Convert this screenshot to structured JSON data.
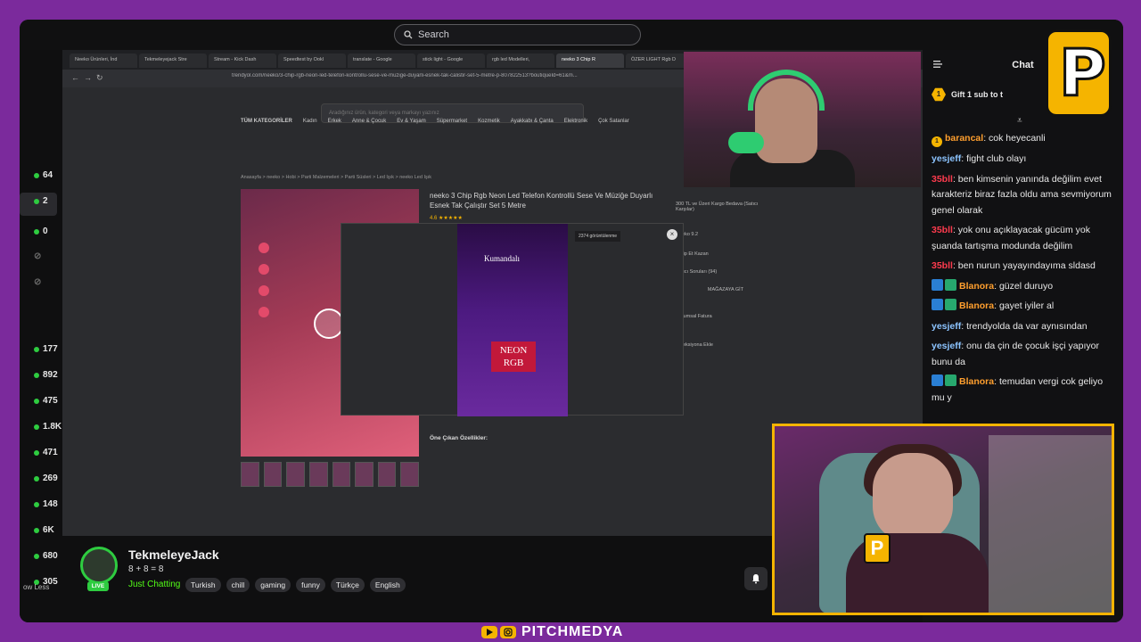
{
  "topbar": {
    "search_placeholder": "Search"
  },
  "leftnav": {
    "items": [
      {
        "value": "64",
        "live": true
      },
      {
        "value": "2",
        "live": true
      },
      {
        "value": "0",
        "live": true
      },
      {
        "value": "",
        "live": false
      },
      {
        "value": "",
        "live": false
      },
      {
        "value": "177",
        "live": true
      },
      {
        "value": "892",
        "live": true
      },
      {
        "value": "475",
        "live": true
      },
      {
        "value": "1.8K",
        "live": true
      },
      {
        "value": "471",
        "live": true
      },
      {
        "value": "269",
        "live": true
      },
      {
        "value": "148",
        "live": true
      },
      {
        "value": "6K",
        "live": true
      },
      {
        "value": "680",
        "live": true
      },
      {
        "value": "305",
        "live": true
      }
    ],
    "show_less": "ow Less"
  },
  "stream": {
    "tabs": [
      "Neeko Ürünleri, İnd",
      "Tekmeleyejack Stre",
      "Stream - Kick Dash",
      "Speedtest by Ookl",
      "translate - Google",
      "stick light - Google",
      "rgb led Modelleri,",
      "neeko 3 Chip R",
      "ÖZER LIGHT Rgb D"
    ],
    "url": "trendyol.com/neeko/3-chip-rgb-neon-led-telefon-kontrollu-sese-ve-muzige-duyarli-esnek-tak-calistir-set-5-metre-p-807822513?boutiqueId=61&m...",
    "site_search_placeholder": "Aradığınız ürün, kategori veya markayı yazınız",
    "categories": [
      "TÜM KATEGORİLER",
      "Kadın",
      "Erkek",
      "Anne & Çocuk",
      "Ev & Yaşam",
      "Süpermarket",
      "Kozmetik",
      "Ayakkabı & Çanta",
      "Elektronik",
      "Çok Satanlar"
    ],
    "breadcrumb": "Anasayfa  >  neeko  >  Hobi  >  Parti Malzemeleri  >  Parti Süsleri  >  Led Işık  >  neeko Led Işık",
    "product_title": "neeko 3 Chip Rgb Neon Led Telefon Kontrollü Sese Ve Müziğe Duyarlı Esnek Tak Çalıştır Set 5 Metre",
    "rating": "4.6",
    "features_title": "Öne Çıkan Özellikler:",
    "modal": {
      "views": "2374 görüntülenme",
      "video_label": "Kumandalı",
      "neon_line1": "NEON",
      "neon_line2": "RGB",
      "close": "×"
    },
    "side_panel": [
      "300 TL ve Üzeri Kargo Bedava (Satıcı Karşılar)",
      "Neeko 9.2",
      "Takip Et Kazan",
      "Satıcı Soruları (94)",
      "MAĞAZAYA GİT",
      "Kurumsal Fatura",
      "Koleksiyona Ekle"
    ]
  },
  "channel": {
    "name": "TekmeleyeJack",
    "title": "8 + 8 = 8",
    "category": "Just Chatting",
    "live_label": "LIVE",
    "tags": [
      "Turkish",
      "chill",
      "gaming",
      "funny",
      "Türkçe",
      "English"
    ]
  },
  "chat": {
    "header": "Chat",
    "gift_text": "Gift 1 sub to t",
    "gift_count": "1",
    "messages": [
      {
        "user": "barancal",
        "color": "orange",
        "badge": "1",
        "text": "cok heyecanli"
      },
      {
        "user": "yesjeff",
        "color": "blue",
        "text": "fight club olayı"
      },
      {
        "user": "35bll",
        "color": "red",
        "text": "ben kimsenin yanında değilim evet karakteriz biraz fazla oldu ama sevmiyorum genel olarak"
      },
      {
        "user": "35bll",
        "color": "red",
        "text": "yok onu açıklayacak gücüm yok şuanda tartışma modunda değilim"
      },
      {
        "user": "35bll",
        "color": "red",
        "text": "ben nurun yayayındayıma sldasd"
      },
      {
        "user": "Blanora",
        "color": "orange",
        "mod": true,
        "text": "güzel duruyo"
      },
      {
        "user": "Blanora",
        "color": "orange",
        "mod": true,
        "text": "gayet iyiler al"
      },
      {
        "user": "yesjeff",
        "color": "blue",
        "text": "trendyolda da var aynısından"
      },
      {
        "user": "yesjeff",
        "color": "blue",
        "text": "onu da çin de çocuk işçi yapıyor bunu da"
      },
      {
        "user": "Blanora",
        "color": "orange",
        "mod": true,
        "text": "temudan vergi cok geliyo mu y"
      }
    ]
  },
  "overlay": {
    "logo_letter": "P",
    "brand": "PITCHMEDYA"
  },
  "colors": {
    "kick_green": "#53fc18",
    "frame_purple": "#7b2a9c",
    "gold": "#f5b400"
  }
}
